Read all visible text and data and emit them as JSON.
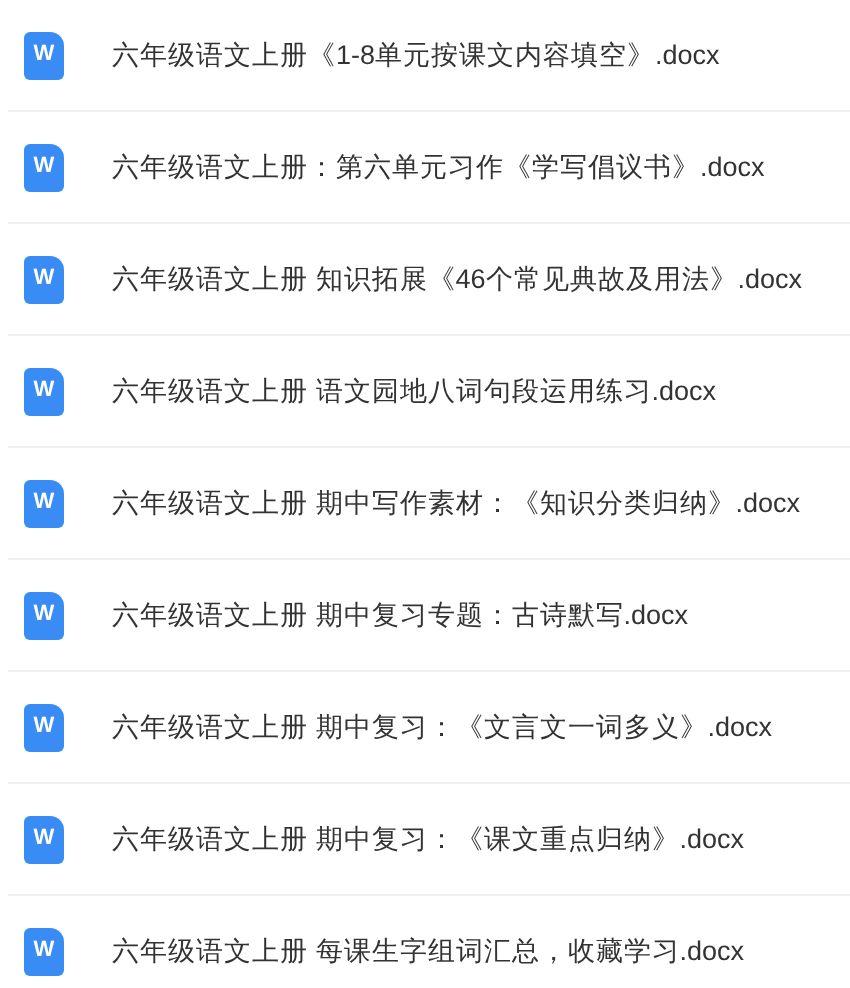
{
  "files": [
    {
      "name": "六年级语文上册《1-8单元按课文内容填空》.docx",
      "icon_letter": "W"
    },
    {
      "name": "六年级语文上册：第六单元习作《学写倡议书》.docx",
      "icon_letter": "W"
    },
    {
      "name": "六年级语文上册 知识拓展《46个常见典故及用法》.docx",
      "icon_letter": "W"
    },
    {
      "name": "六年级语文上册 语文园地八词句段运用练习.docx",
      "icon_letter": "W"
    },
    {
      "name": "六年级语文上册 期中写作素材：《知识分类归纳》.docx",
      "icon_letter": "W"
    },
    {
      "name": "六年级语文上册 期中复习专题：古诗默写.docx",
      "icon_letter": "W"
    },
    {
      "name": "六年级语文上册 期中复习：《文言文一词多义》.docx",
      "icon_letter": "W"
    },
    {
      "name": "六年级语文上册 期中复习：《课文重点归纳》.docx",
      "icon_letter": "W"
    },
    {
      "name": "六年级语文上册 每课生字组词汇总，收藏学习.docx",
      "icon_letter": "W"
    }
  ]
}
